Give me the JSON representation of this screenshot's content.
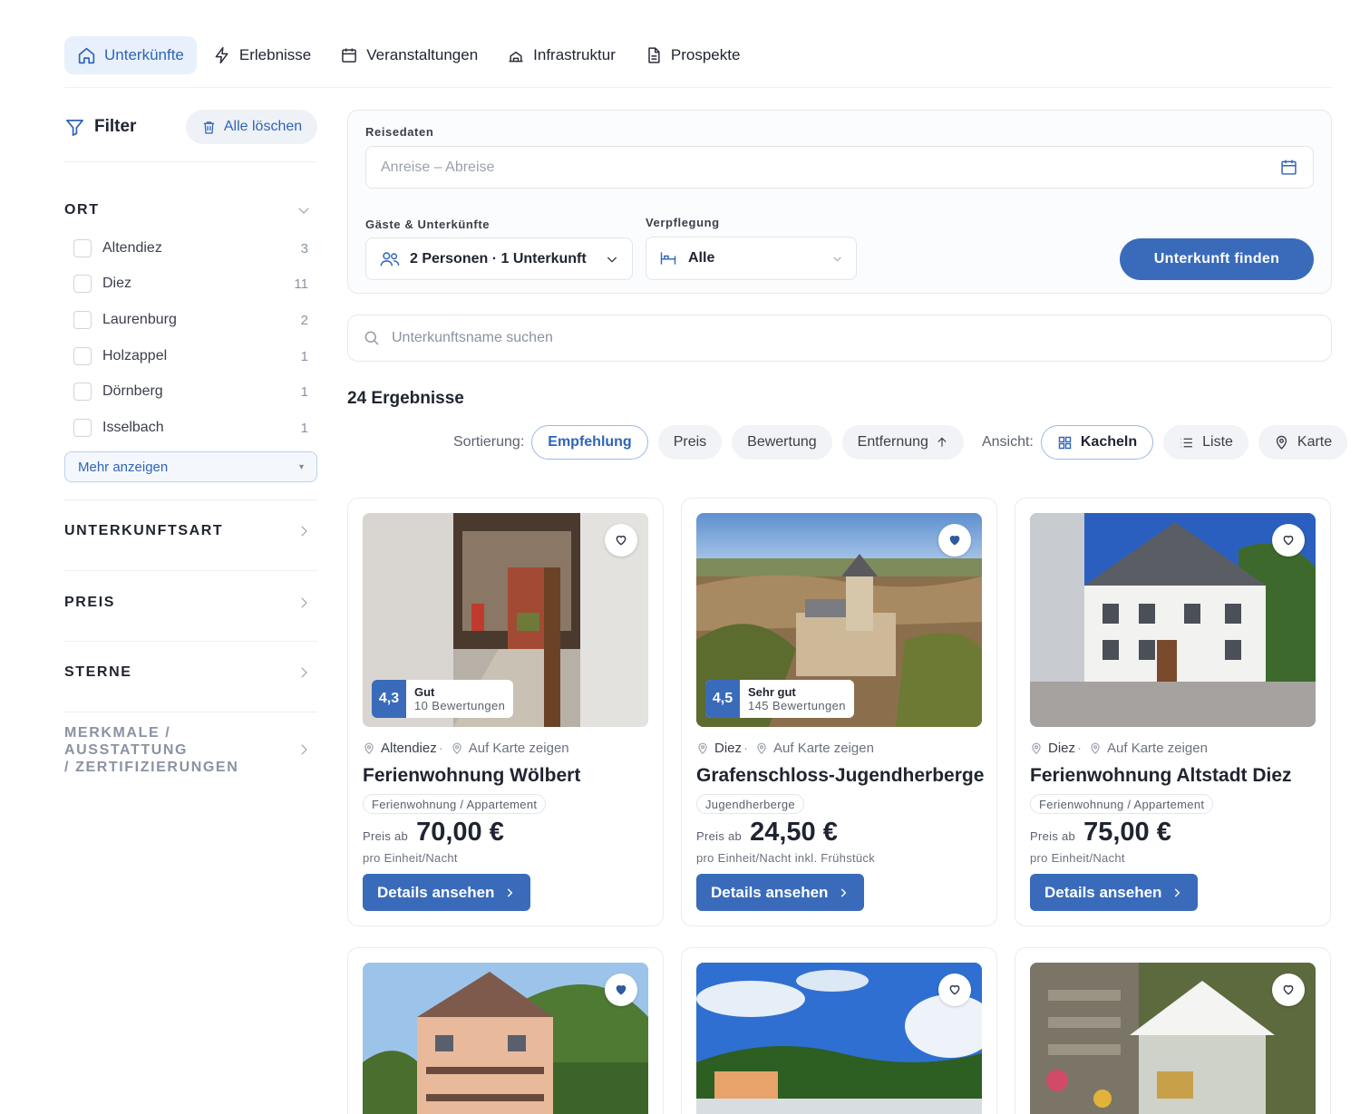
{
  "tabs": [
    {
      "label": "Unterkünfte",
      "icon": "home-icon",
      "active": true
    },
    {
      "label": "Erlebnisse",
      "icon": "lightning-icon",
      "active": false
    },
    {
      "label": "Veranstaltungen",
      "icon": "calendar-icon",
      "active": false
    },
    {
      "label": "Infrastruktur",
      "icon": "building-icon",
      "active": false
    },
    {
      "label": "Prospekte",
      "icon": "document-icon",
      "active": false
    }
  ],
  "sidebar": {
    "filter_title": "Filter",
    "clear_all": "Alle löschen",
    "ort": {
      "title": "ORT",
      "items": [
        {
          "label": "Altendiez",
          "count": "3"
        },
        {
          "label": "Diez",
          "count": "11"
        },
        {
          "label": "Laurenburg",
          "count": "2"
        },
        {
          "label": "Holzappel",
          "count": "1"
        },
        {
          "label": "Dörnberg",
          "count": "1"
        },
        {
          "label": "Isselbach",
          "count": "1"
        }
      ],
      "more": "Mehr anzeigen"
    },
    "sections": [
      {
        "title": "UNTERKUNFTSART"
      },
      {
        "title": "PREIS"
      },
      {
        "title": "STERNE"
      },
      {
        "title_line1": "MERKMALE / AUSSTATTUNG",
        "title_line2": "/ ZERTIFIZIERUNGEN"
      }
    ]
  },
  "search": {
    "dates_label": "Reisedaten",
    "dates_placeholder": "Anreise – Abreise",
    "guests_label": "Gäste & Unterkünfte",
    "guests_value": "2 Personen · 1 Unterkunft",
    "board_label": "Verpflegung",
    "board_value": "Alle",
    "submit": "Unterkunft finden",
    "name_placeholder": "Unterkunftsname suchen"
  },
  "results": {
    "count_text": "24 Ergebnisse",
    "sort_label": "Sortierung:",
    "sort_options": [
      "Empfehlung",
      "Preis",
      "Bewertung",
      "Entfernung"
    ],
    "sort_active": "Empfehlung",
    "view_label": "Ansicht:",
    "view_options": [
      "Kacheln",
      "Liste",
      "Karte"
    ],
    "view_active": "Kacheln"
  },
  "cards": [
    {
      "rating_score": "4,3",
      "rating_text": "Gut",
      "rating_count": "10 Bewertungen",
      "location": "Altendiez",
      "map_link": "Auf Karte zeigen",
      "title": "Ferienwohnung Wölbert",
      "type": "Ferienwohnung / Appartement",
      "price_prefix": "Preis ab",
      "price": "70,00 €",
      "price_unit": "pro Einheit/Nacht",
      "details": "Details ansehen",
      "favorite": false
    },
    {
      "rating_score": "4,5",
      "rating_text": "Sehr gut",
      "rating_count": "145 Bewertungen",
      "location": "Diez",
      "map_link": "Auf Karte zeigen",
      "title": "Grafenschloss-Jugendherberge",
      "type": "Jugendherberge",
      "price_prefix": "Preis ab",
      "price": "24,50 €",
      "price_unit": "pro Einheit/Nacht inkl. Frühstück",
      "details": "Details ansehen",
      "favorite": true
    },
    {
      "location": "Diez",
      "map_link": "Auf Karte zeigen",
      "title": "Ferienwohnung Altstadt Diez",
      "type": "Ferienwohnung / Appartement",
      "price_prefix": "Preis ab",
      "price": "75,00 €",
      "price_unit": "pro Einheit/Nacht",
      "details": "Details ansehen",
      "favorite": false
    },
    {
      "favorite": true
    },
    {
      "favorite": false
    },
    {
      "favorite": false
    }
  ],
  "colors": {
    "accent": "#3a6bbb",
    "accent_text": "#2f64b8",
    "active_tab_bg": "#e8f0fb"
  }
}
